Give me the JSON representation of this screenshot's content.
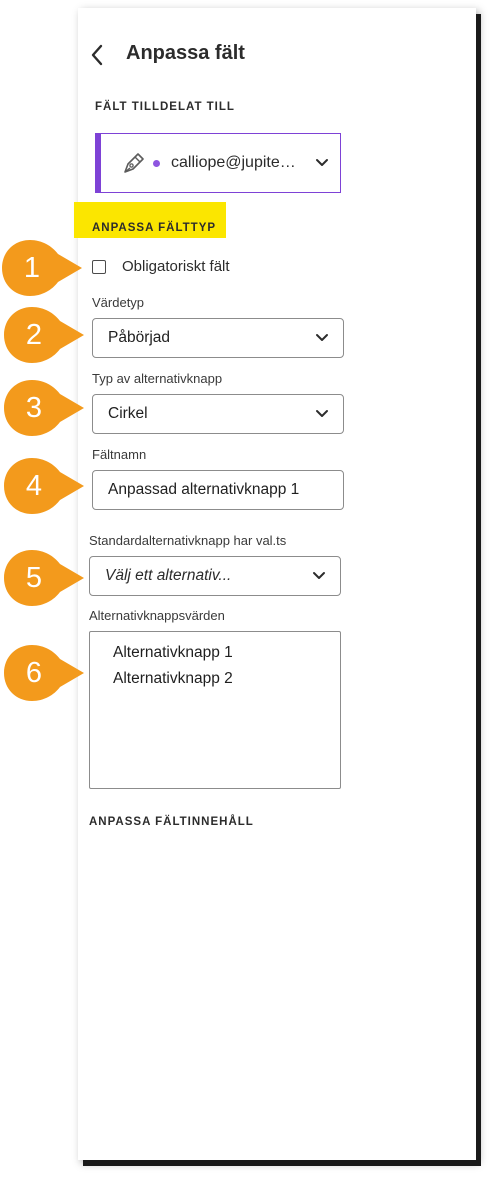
{
  "header": {
    "title": "Anpassa fält"
  },
  "assigned": {
    "section_label": "FÄLT TILLDELAT TILL",
    "email": "calliope@jupite…"
  },
  "customize_type": {
    "section_label": "ANPASSA FÄLTTYP"
  },
  "required": {
    "label": "Obligatoriskt fält"
  },
  "value_type": {
    "label": "Värdetyp",
    "value": "Påbörjad"
  },
  "radio_type": {
    "label": "Typ av alternativknapp",
    "value": "Cirkel"
  },
  "field_name": {
    "label": "Fältnamn",
    "value": "Anpassad alternativknapp 1"
  },
  "default_radio": {
    "label": "Standardalternativknapp har val.ts",
    "placeholder": "Välj ett alternativ..."
  },
  "radio_values": {
    "label": "Alternativknappsvärden",
    "items": [
      "Alternativknapp 1",
      "Alternativknapp 2"
    ]
  },
  "customize_content": {
    "section_label": "ANPASSA FÄLTINNEHÅLL"
  },
  "callouts": [
    "1",
    "2",
    "3",
    "4",
    "5",
    "6"
  ],
  "colors": {
    "accent": "#7e42d6",
    "highlight": "#fbe600",
    "callout": "#f39a1c"
  }
}
